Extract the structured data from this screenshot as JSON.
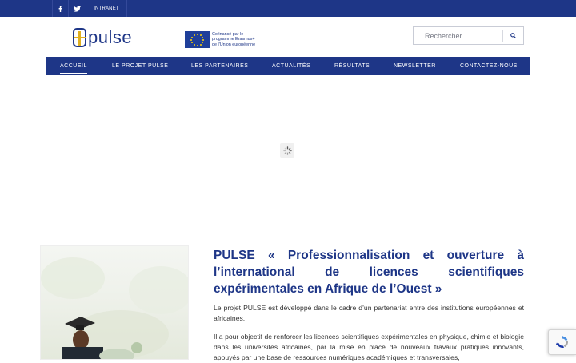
{
  "topbar": {
    "facebook_icon": "facebook-icon",
    "twitter_icon": "twitter-icon",
    "intranet_label": "INTRANET"
  },
  "header": {
    "logo_text": "pulse",
    "eu_text_line1": "Cofinancé par le",
    "eu_text_line2": "programme Erasmus+",
    "eu_text_line3": "de l'Union européenne",
    "search_placeholder": "Rechercher",
    "search_icon": "search-icon"
  },
  "nav": {
    "items": [
      {
        "label": "ACCUEIL",
        "active": true
      },
      {
        "label": "LE PROJET PULSE"
      },
      {
        "label": "LES PARTENAIRES"
      },
      {
        "label": "ACTUALITÉS"
      },
      {
        "label": "RÉSULTATS"
      },
      {
        "label": "NEWSLETTER"
      },
      {
        "label": "CONTACTEZ-NOUS"
      }
    ]
  },
  "main": {
    "heading": "PULSE « Professionnalisation et ouverture à l’international de licences scientifiques expérimentales en Afrique de l’Ouest »",
    "paragraph1": "Le projet PULSE est développé dans le cadre d’un partenariat entre des institutions européennes et africaines.",
    "paragraph2": "Il a pour objectif de renforcer les licences scientifiques expérimentales en physique, chimie et biologie dans les universités africaines, par la mise en place de nouveaux travaux pratiques innovants, appuyés par une base de ressources numériques académiques et transversales,"
  },
  "colors": {
    "brand_blue": "#1e3687",
    "accent_yellow": "#e0b020"
  }
}
